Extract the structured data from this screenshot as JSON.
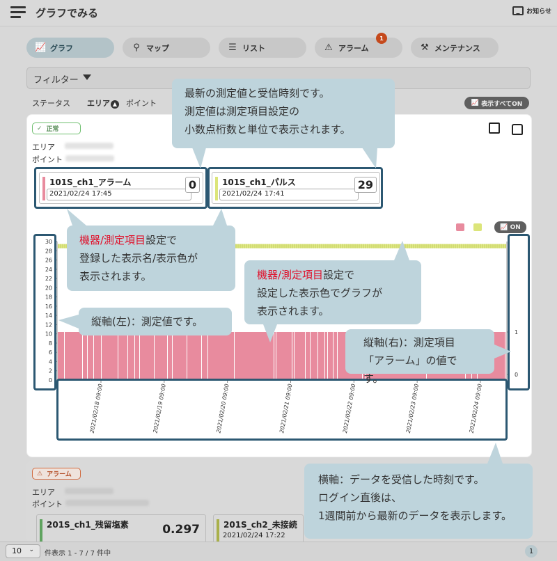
{
  "header": {
    "title": "グラフでみる",
    "notice_label": "お知らせ"
  },
  "tabs": [
    {
      "label": "グラフ",
      "icon": "chart-icon"
    },
    {
      "label": "マップ",
      "icon": "map-icon"
    },
    {
      "label": "リスト",
      "icon": "list-icon"
    },
    {
      "label": "アラーム",
      "icon": "warning-icon",
      "badge": "1"
    },
    {
      "label": "メンテナンス",
      "icon": "tools-icon"
    }
  ],
  "filter": {
    "label": "フィルター"
  },
  "sort": {
    "status": "ステータス",
    "area": "エリア",
    "point": "ポイント"
  },
  "show_all": "表示すべてON",
  "card1": {
    "status": "正常",
    "area_label": "エリア",
    "point_label": "ポイント",
    "tiles": [
      {
        "name": "101S_ch1_アラーム",
        "time": "2021/02/24 17:45",
        "value": "0",
        "color": "#e88b9e"
      },
      {
        "name": "101S_ch1_パルス",
        "time": "2021/02/24 17:41",
        "value": "29",
        "color": "#dce57a"
      }
    ],
    "legend_on": "ON"
  },
  "chart_data": {
    "type": "bar",
    "series": [
      {
        "name": "101S_ch1_アラーム",
        "color": "#e88b9e",
        "axis": "right",
        "values_note": "alarm state",
        "value": 1
      },
      {
        "name": "101S_ch1_パルス",
        "color": "#dce57a",
        "axis": "left",
        "value": 29
      }
    ],
    "left_ticks": [
      "30",
      "28",
      "26",
      "24",
      "22",
      "20",
      "18",
      "16",
      "14",
      "12",
      "10",
      "8",
      "6",
      "4",
      "2",
      "0"
    ],
    "right_ticks": [
      "1",
      "0"
    ],
    "x_ticks": [
      "2021/02/18 09:00",
      "2021/02/19 09:00",
      "2021/02/20 09:00",
      "2021/02/21 09:00",
      "2021/02/22 09:00",
      "2021/02/23 09:00",
      "2021/02/24 09:00"
    ]
  },
  "card2": {
    "status": "アラーム",
    "area_label": "エリア",
    "point_label": "ポイント",
    "tiles": [
      {
        "name": "201S_ch1_残留塩素",
        "value": "0.297",
        "color": "#5fa35f"
      },
      {
        "name": "201S_ch2_未接続",
        "time": "2021/02/24 17:22",
        "color": "#a9b04a"
      }
    ]
  },
  "callouts": {
    "top": [
      "最新の測定値と受信時刻です。",
      "測定値は測定項目設定の",
      "小数点桁数と単位で表示されます。"
    ],
    "name_pre": "機器/測定項目",
    "name_post": "設定で",
    "name_lines": [
      "登録した表示名/表示色が",
      "表示されます。"
    ],
    "color_pre": "機器/測定項目",
    "color_post": "設定で",
    "color_lines": [
      "設定した表示色でグラフが",
      "表示されます。"
    ],
    "left_axis": "縦軸(左)：測定値です。",
    "right_axis": [
      "縦軸(右)：測定項目",
      "「アラーム」の値です。"
    ],
    "x_axis": [
      "横軸：データを受信した時刻です。",
      "ログイン直後は、",
      "1週間前から最新のデータを表示します。"
    ]
  },
  "footer": {
    "per_page": "10",
    "info": "件表示  1 - 7 / 7 件中",
    "page": "1"
  }
}
